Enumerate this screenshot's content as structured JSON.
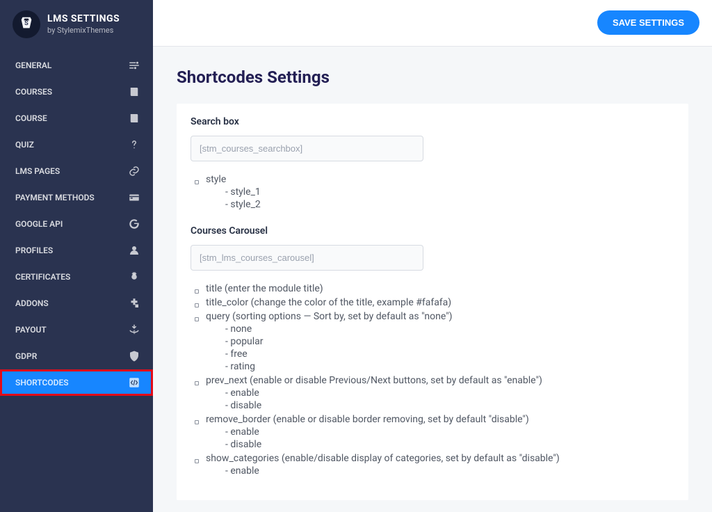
{
  "brand": {
    "title": "LMS SETTINGS",
    "subtitle": "by StylemixThemes"
  },
  "save_label": "SAVE SETTINGS",
  "page_title": "Shortcodes Settings",
  "nav": [
    {
      "label": "GENERAL",
      "icon": "sliders"
    },
    {
      "label": "COURSES",
      "icon": "book"
    },
    {
      "label": "COURSE",
      "icon": "book"
    },
    {
      "label": "QUIZ",
      "icon": "question"
    },
    {
      "label": "LMS PAGES",
      "icon": "link"
    },
    {
      "label": "PAYMENT METHODS",
      "icon": "card"
    },
    {
      "label": "GOOGLE API",
      "icon": "google"
    },
    {
      "label": "PROFILES",
      "icon": "user"
    },
    {
      "label": "CERTIFICATES",
      "icon": "badge"
    },
    {
      "label": "ADDONS",
      "icon": "plugin"
    },
    {
      "label": "PAYOUT",
      "icon": "payout"
    },
    {
      "label": "GDPR",
      "icon": "shield"
    },
    {
      "label": "SHORTCODES",
      "icon": "shortcode",
      "active": true,
      "highlight": true
    }
  ],
  "sections": [
    {
      "title": "Search box",
      "shortcode": "[stm_courses_searchbox]",
      "attrs": [
        {
          "name": "style",
          "values": [
            "style_1",
            "style_2"
          ]
        }
      ]
    },
    {
      "title": "Courses Carousel",
      "shortcode": "[stm_lms_courses_carousel]",
      "attrs": [
        {
          "name": "title",
          "note": "(enter the module title)"
        },
        {
          "name": "title_color",
          "note": "(change the color of the title, example #fafafa)"
        },
        {
          "name": "query",
          "note": "(sorting options — Sort by, set by default as \"none\")",
          "values": [
            "none",
            "popular",
            "free",
            "rating"
          ]
        },
        {
          "name": "prev_next",
          "note": "(enable or disable Previous/Next buttons, set by default as \"enable\")",
          "values": [
            "enable",
            "disable"
          ]
        },
        {
          "name": "remove_border",
          "note": "(enable or disable border removing, set by default \"disable\")",
          "values": [
            "enable",
            "disable"
          ]
        },
        {
          "name": "show_categories",
          "note": "(enable/disable display of categories, set by default as \"disable\")",
          "values": [
            "enable"
          ]
        }
      ]
    }
  ]
}
